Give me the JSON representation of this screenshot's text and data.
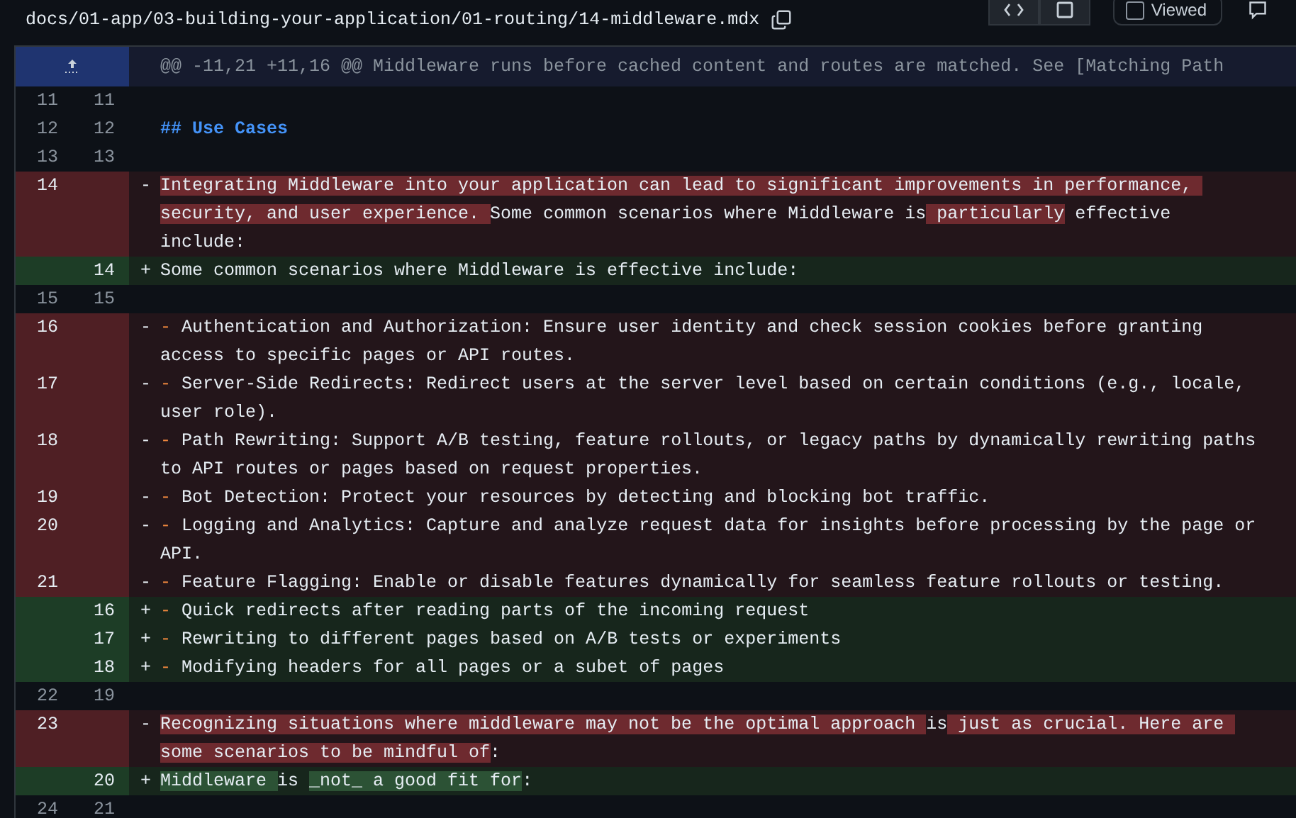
{
  "file": {
    "path": "docs/01-app/03-building-your-application/01-routing/14-middleware.mdx",
    "viewed_label": "Viewed",
    "viewed": false
  },
  "hunk": {
    "header": "@@ -11,21 +11,16 @@ Middleware runs before cached content and routes are matched. See [Matching Path"
  },
  "lines": [
    {
      "kind": "context",
      "old": "11",
      "new": "11"
    },
    {
      "kind": "heading",
      "old": "12",
      "new": "12",
      "segments": [
        {
          "text": "## Use Cases",
          "highlighted": false
        }
      ]
    },
    {
      "kind": "context",
      "old": "13",
      "new": "13"
    },
    {
      "kind": "del",
      "old": "14",
      "sign": "-",
      "segments": [
        {
          "text": "Integrating Middleware into your application can lead to significant improvements in performance, security, and user experience. ",
          "highlighted": true
        },
        {
          "text": "Some common scenarios where Middleware is",
          "highlighted": false
        },
        {
          "text": " particularly",
          "highlighted": true
        },
        {
          "text": " effective include:",
          "highlighted": false
        }
      ]
    },
    {
      "kind": "add",
      "new": "14",
      "sign": "+",
      "segments": [
        {
          "text": "Some common scenarios where Middleware is effective include:",
          "highlighted": false
        }
      ]
    },
    {
      "kind": "context",
      "old": "15",
      "new": "15"
    },
    {
      "kind": "del",
      "old": "16",
      "sign": "-",
      "bullet": "-",
      "segments": [
        {
          "text": "Authentication and Authorization: Ensure user identity and check session cookies before granting access to specific pages or API routes.",
          "highlighted": false
        }
      ]
    },
    {
      "kind": "del",
      "old": "17",
      "sign": "-",
      "bullet": "-",
      "segments": [
        {
          "text": "Server-Side Redirects: Redirect users at the server level based on certain conditions (e.g., locale, user role).",
          "highlighted": false
        }
      ]
    },
    {
      "kind": "del",
      "old": "18",
      "sign": "-",
      "bullet": "-",
      "segments": [
        {
          "text": "Path Rewriting: Support A/B testing, feature rollouts, or legacy paths by dynamically rewriting paths to API routes or pages based on request properties.",
          "highlighted": false
        }
      ]
    },
    {
      "kind": "del",
      "old": "19",
      "sign": "-",
      "bullet": "-",
      "segments": [
        {
          "text": "Bot Detection: Protect your resources by detecting and blocking bot traffic.",
          "highlighted": false
        }
      ]
    },
    {
      "kind": "del",
      "old": "20",
      "sign": "-",
      "bullet": "-",
      "segments": [
        {
          "text": "Logging and Analytics: Capture and analyze request data for insights before processing by the page or API.",
          "highlighted": false
        }
      ]
    },
    {
      "kind": "del",
      "old": "21",
      "sign": "-",
      "bullet": "-",
      "segments": [
        {
          "text": "Feature Flagging: Enable or disable features dynamically for seamless feature rollouts or testing.",
          "highlighted": false
        }
      ]
    },
    {
      "kind": "add",
      "new": "16",
      "sign": "+",
      "bullet": "-",
      "segments": [
        {
          "text": "Quick redirects after reading parts of the incoming request",
          "highlighted": false
        }
      ]
    },
    {
      "kind": "add",
      "new": "17",
      "sign": "+",
      "bullet": "-",
      "segments": [
        {
          "text": "Rewriting to different pages based on A/B tests or experiments",
          "highlighted": false
        }
      ]
    },
    {
      "kind": "add",
      "new": "18",
      "sign": "+",
      "bullet": "-",
      "segments": [
        {
          "text": "Modifying headers for all pages or a subet of pages",
          "highlighted": false
        }
      ]
    },
    {
      "kind": "context",
      "old": "22",
      "new": "19"
    },
    {
      "kind": "del",
      "old": "23",
      "sign": "-",
      "segments": [
        {
          "text": "Recognizing situations where middleware may not be the optimal approach ",
          "highlighted": true
        },
        {
          "text": "is",
          "highlighted": false
        },
        {
          "text": " just as crucial. Here are some scenarios to be mindful of",
          "highlighted": true
        },
        {
          "text": ":",
          "highlighted": false
        }
      ]
    },
    {
      "kind": "add",
      "new": "20",
      "sign": "+",
      "segments": [
        {
          "text": "Middleware ",
          "highlighted": true
        },
        {
          "text": "is ",
          "highlighted": false
        },
        {
          "text": "_not_ a good fit for",
          "highlighted": true
        },
        {
          "text": ":",
          "highlighted": false
        }
      ]
    },
    {
      "kind": "context",
      "old": "24",
      "new": "21"
    }
  ]
}
